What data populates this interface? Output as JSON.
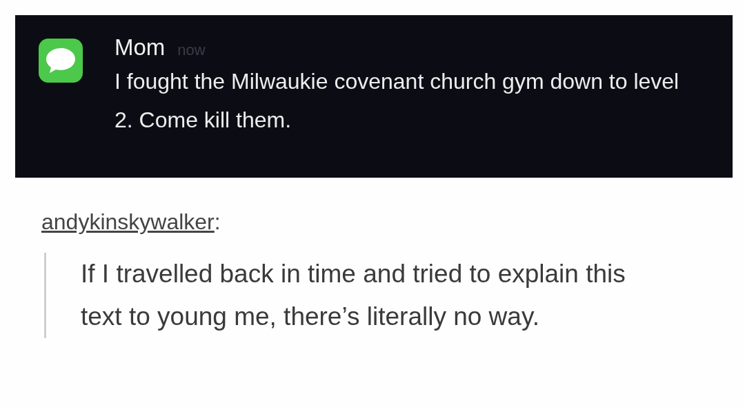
{
  "notification": {
    "sender": "Mom",
    "time": "now",
    "message": "I fought the Milwaukie covenant church gym down to level 2. Come kill them."
  },
  "post": {
    "username": "andykinskywalker",
    "after_username": ":",
    "quote": "If I travelled back in time and tried to explain this text to young me, there’s literally no way."
  }
}
